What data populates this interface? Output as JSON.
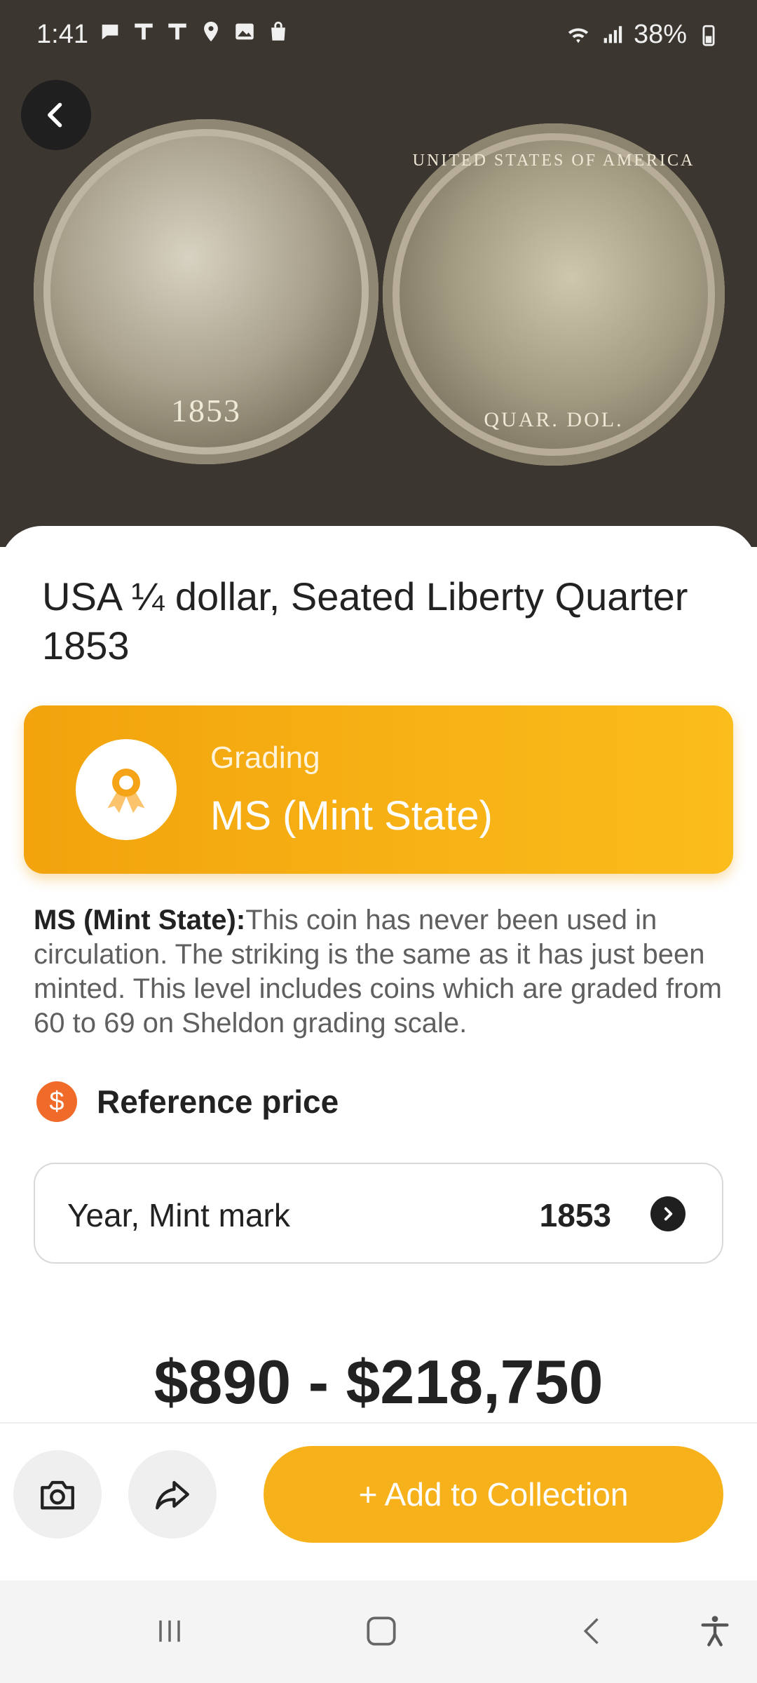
{
  "status_bar": {
    "time": "1:41",
    "battery": "38%"
  },
  "hero": {
    "coin_obverse_date": "1853",
    "coin_reverse_legend": "UNITED STATES OF AMERICA",
    "coin_reverse_denomination": "QUAR. DOL."
  },
  "coin": {
    "title": "USA ¼ dollar, Seated Liberty Quarter 1853"
  },
  "grading": {
    "label": "Grading",
    "value": "MS (Mint State)"
  },
  "description": {
    "term": "MS (Mint State):",
    "text": "This coin has never been used in circulation. The striking is the same as it has just been minted. This level includes coins which are graded from 60 to 69 on Sheldon grading scale."
  },
  "reference_price": {
    "icon_symbol": "$",
    "title": "Reference price",
    "year_label": "Year, Mint mark",
    "year_value": "1853",
    "price_range": "$890 - $218,750"
  },
  "actions": {
    "add_label": "+ Add to Collection"
  },
  "colors": {
    "accent": "#f7b21b",
    "grading_gradient_start": "#f2a30d",
    "grading_gradient_end": "#fbbd1b",
    "price_icon": "#f06a2a",
    "hero_background": "#3b3730"
  },
  "icons": [
    "back-arrow-icon",
    "medal-icon",
    "dollar-icon",
    "chevron-right-icon",
    "camera-icon",
    "share-icon",
    "recent-apps-icon",
    "home-icon",
    "nav-back-icon",
    "accessibility-icon"
  ]
}
